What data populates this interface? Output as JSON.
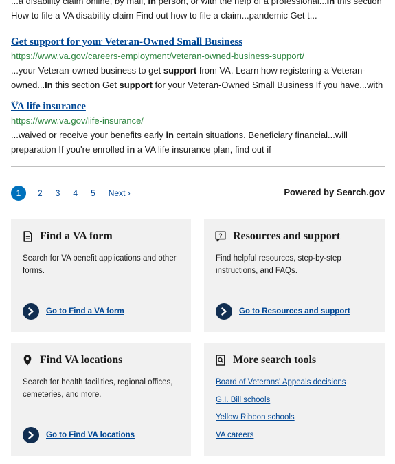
{
  "top_snippet": {
    "part1": "...a disability claim online, by mail, ",
    "bold1": "in",
    "part2": " person, or with the help of a professional...",
    "bold2": "In",
    "part3": " this section How to file a VA disability claim Find out how to file a claim...pandemic Get t..."
  },
  "results": [
    {
      "title": "Get support for your Veteran-Owned Small Business",
      "url": "https://www.va.gov/careers-employment/veteran-owned-business-support/",
      "snippet": {
        "t1": "...your Veteran-owned business to get ",
        "b1": "support",
        "t2": " from VA. Learn how registering a Veteran-owned...",
        "b2": "In",
        "t3": " this section Get ",
        "b3": "support",
        "t4": " for your Veteran-Owned Small Business If you have...with ..."
      }
    },
    {
      "title": "VA life insurance",
      "url": "https://www.va.gov/life-insurance/",
      "snippet": {
        "t1": "...waived or receive your benefits early ",
        "b1": "in",
        "t2": " certain situations. Beneficiary financial...will preparation If you're enrolled ",
        "b2": "in",
        "t3": " a VA life insurance plan, find out if"
      }
    }
  ],
  "pagination": {
    "pages": [
      "1",
      "2",
      "3",
      "4",
      "5"
    ],
    "current": "1",
    "next_label": "Next ›"
  },
  "powered_by": "Powered by Search.gov",
  "cards": {
    "find_form": {
      "icon": "document-icon",
      "title": "Find a VA form",
      "description": "Search for VA benefit applications and other forms.",
      "action": "Go to Find a VA form"
    },
    "resources": {
      "icon": "question-icon",
      "title": "Resources and support",
      "description": "Find helpful resources, step-by-step instructions, and FAQs.",
      "action": "Go to Resources and support"
    },
    "locations": {
      "icon": "map-marker-icon",
      "title": "Find VA locations",
      "description": "Search for health facilities, regional offices, cemeteries, and more.",
      "action": "Go to Find VA locations"
    },
    "tools": {
      "icon": "search-document-icon",
      "title": "More search tools",
      "links": [
        "Board of Veterans' Appeals decisions",
        "G.I. Bill schools",
        "Yellow Ribbon schools",
        "VA careers"
      ]
    }
  },
  "colors": {
    "link": "#004795",
    "url_green": "#2e8540",
    "card_bg": "#f1f1f1",
    "pagination_current": "#0071bc",
    "action_circle": "#112e51"
  }
}
